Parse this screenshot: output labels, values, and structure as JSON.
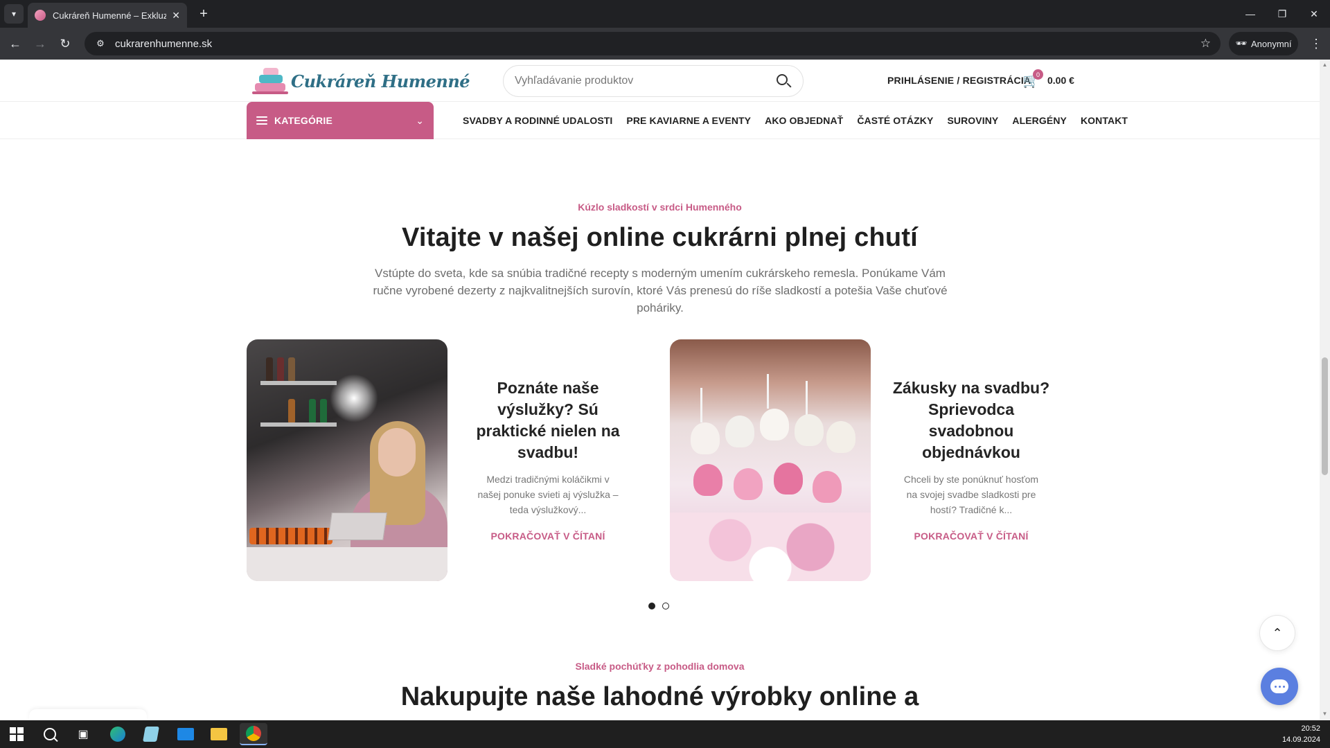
{
  "browser": {
    "tab_title": "Cukráreň Humenné – Exkluzívne",
    "url": "cukrarenhumenne.sk",
    "profile_label": "Anonymní"
  },
  "site": {
    "logo_text": "Cukráreň Humenné",
    "search_placeholder": "Vyhľadávanie produktov",
    "login_label": "PRIHLÁSENIE / REGISTRÁCIA",
    "cart_count": "0",
    "cart_total": "0.00 €",
    "categories_label": "KATEGÓRIE",
    "nav": [
      "SVADBY A RODINNÉ UDALOSTI",
      "PRE KAVIARNE A EVENTY",
      "AKO OBJEDNAŤ",
      "ČASTÉ OTÁZKY",
      "SUROVINY",
      "ALERGÉNY",
      "KONTAKT"
    ]
  },
  "welcome": {
    "kicker": "Kúzlo sladkostí v srdci Humenného",
    "title": "Vitajte v našej online cukrárni plnej chutí",
    "intro_lines": [
      "Vstúpte do sveta, kde sa snúbia tradičné recepty s moderným umením cukrárskeho remesla. Ponúkame Vám",
      "ručne vyrobené dezerty z najkvalitnejších surovín, ktoré Vás prenesú do ríše sladkostí a potešia Vaše chuťové",
      "poháriky."
    ]
  },
  "posts": [
    {
      "title_lines": [
        "Poznáte naše",
        "výslužky? Sú",
        "praktické nielen na",
        "svadbu!"
      ],
      "excerpt_lines": [
        "Medzi tradičnými koláčikmi v",
        "našej ponuke svieti aj výslužka –",
        "teda výslužkový..."
      ],
      "read_more": "POKRAČOVAŤ V ČÍTANÍ"
    },
    {
      "title_lines": [
        "Zákusky na svadbu?",
        "Sprievodca",
        "svadobnou",
        "objednávkou"
      ],
      "excerpt_lines": [
        "Chceli by ste ponúknuť hosťom",
        "na svojej svadbe sladkosti pre",
        "hostí? Tradičné k..."
      ],
      "read_more": "POKRAČOVAŤ V ČÍTANÍ"
    }
  ],
  "carousel": {
    "pages": 2,
    "active": 1
  },
  "shop": {
    "kicker": "Sladké pochúťky z pohodlia domova",
    "title": "Nakupujte naše lahodné výrobky online a"
  },
  "taskbar": {
    "time": "20:52",
    "date": "14.09.2024"
  },
  "colors": {
    "accent": "#c75b86",
    "chat": "#5b7fe0"
  }
}
